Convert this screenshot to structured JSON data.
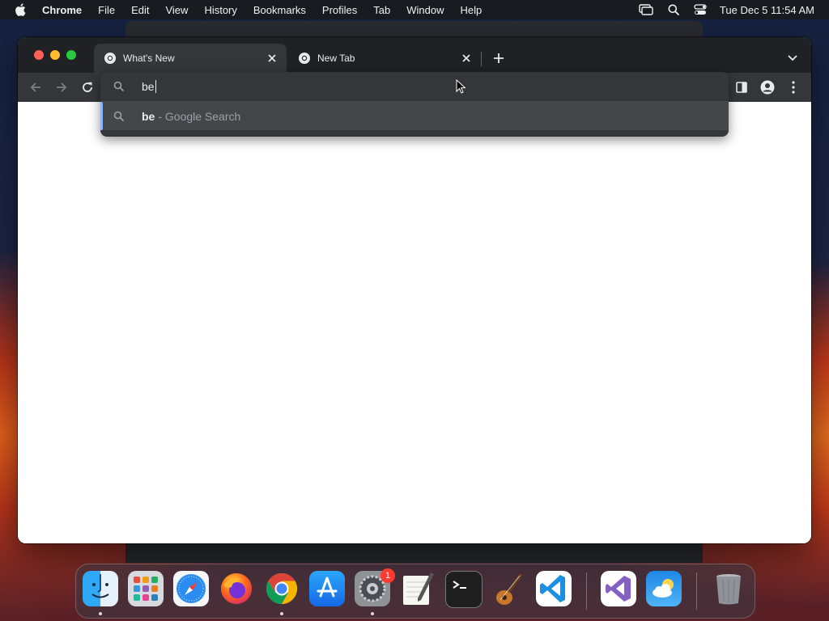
{
  "menubar": {
    "app_name": "Chrome",
    "items": [
      "File",
      "Edit",
      "View",
      "History",
      "Bookmarks",
      "Profiles",
      "Tab",
      "Window",
      "Help"
    ],
    "clock": "Tue Dec 5  11:54 AM"
  },
  "tabs": [
    {
      "title": "What's New",
      "active": true
    },
    {
      "title": "New Tab",
      "active": false
    }
  ],
  "omnibox": {
    "query": "be",
    "suggestion": {
      "text": "be",
      "description": "- Google Search"
    }
  },
  "dock": {
    "apps": [
      "Finder",
      "Launchpad",
      "Safari",
      "Firefox",
      "Google Chrome",
      "App Store",
      "System Settings",
      "TextEdit",
      "Terminal",
      "GarageBand",
      "Visual Studio Code",
      "Visual Studio",
      "Weather",
      "Trash"
    ],
    "system_settings_badge": "1"
  },
  "colors": {
    "tabstrip": "#202124",
    "toolbar": "#35363a",
    "suggestion_highlight": "#45464a",
    "focus_accent": "#8ab4f8"
  }
}
